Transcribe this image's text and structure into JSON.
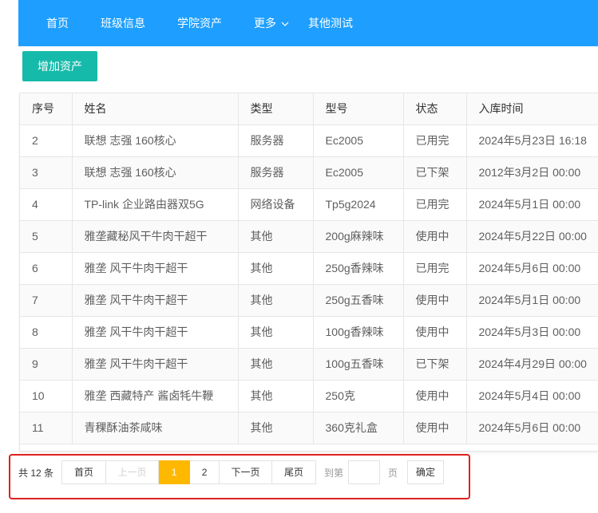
{
  "nav": {
    "items": [
      {
        "label": "首页"
      },
      {
        "label": "班级信息"
      },
      {
        "label": "学院资产"
      },
      {
        "label": "更多"
      },
      {
        "label": "其他测试"
      }
    ]
  },
  "toolbar": {
    "add_label": "增加资产"
  },
  "table": {
    "headers": [
      "序号",
      "姓名",
      "类型",
      "型号",
      "状态",
      "入库时间"
    ],
    "rows": [
      [
        "2",
        "联想 志强 160核心",
        "服务器",
        "Ec2005",
        "已用完",
        "2024年5月23日 16:18"
      ],
      [
        "3",
        "联想 志强 160核心",
        "服务器",
        "Ec2005",
        "已下架",
        "2012年3月2日 00:00"
      ],
      [
        "4",
        "TP-link 企业路由器双5G",
        "网络设备",
        "Tp5g2024",
        "已用完",
        "2024年5月1日 00:00"
      ],
      [
        "5",
        "雅垄藏秘风干牛肉干超干",
        "其他",
        "200g麻辣味",
        "使用中",
        "2024年5月22日 00:00"
      ],
      [
        "6",
        "雅垄 风干牛肉干超干",
        "其他",
        "250g香辣味",
        "已用完",
        "2024年5月6日 00:00"
      ],
      [
        "7",
        "雅垄 风干牛肉干超干",
        "其他",
        "250g五香味",
        "使用中",
        "2024年5月1日 00:00"
      ],
      [
        "8",
        "雅垄 风干牛肉干超干",
        "其他",
        "100g香辣味",
        "使用中",
        "2024年5月3日 00:00"
      ],
      [
        "9",
        "雅垄 风干牛肉干超干",
        "其他",
        "100g五香味",
        "已下架",
        "2024年4月29日 00:00"
      ],
      [
        "10",
        "雅垄 西藏特产 酱卤牦牛鞭",
        "其他",
        "250克",
        "使用中",
        "2024年5月4日 00:00"
      ],
      [
        "11",
        "青稞酥油茶咸味",
        "其他",
        "360克礼盒",
        "使用中",
        "2024年5月6日 00:00"
      ]
    ]
  },
  "pager": {
    "count": "共 12 条",
    "first": "首页",
    "prev": "上一页",
    "page1": "1",
    "page2": "2",
    "next": "下一页",
    "last": "尾页",
    "goto": "到第",
    "goto_value": "",
    "page_unit": "页",
    "confirm": "确定"
  },
  "colors": {
    "nav_bg": "#1e9fff",
    "add_button": "#16baaa",
    "current_page": "#ffb800",
    "highlight_border": "#e02020"
  },
  "icons": {
    "more_dropdown": "chevron-down-icon"
  }
}
